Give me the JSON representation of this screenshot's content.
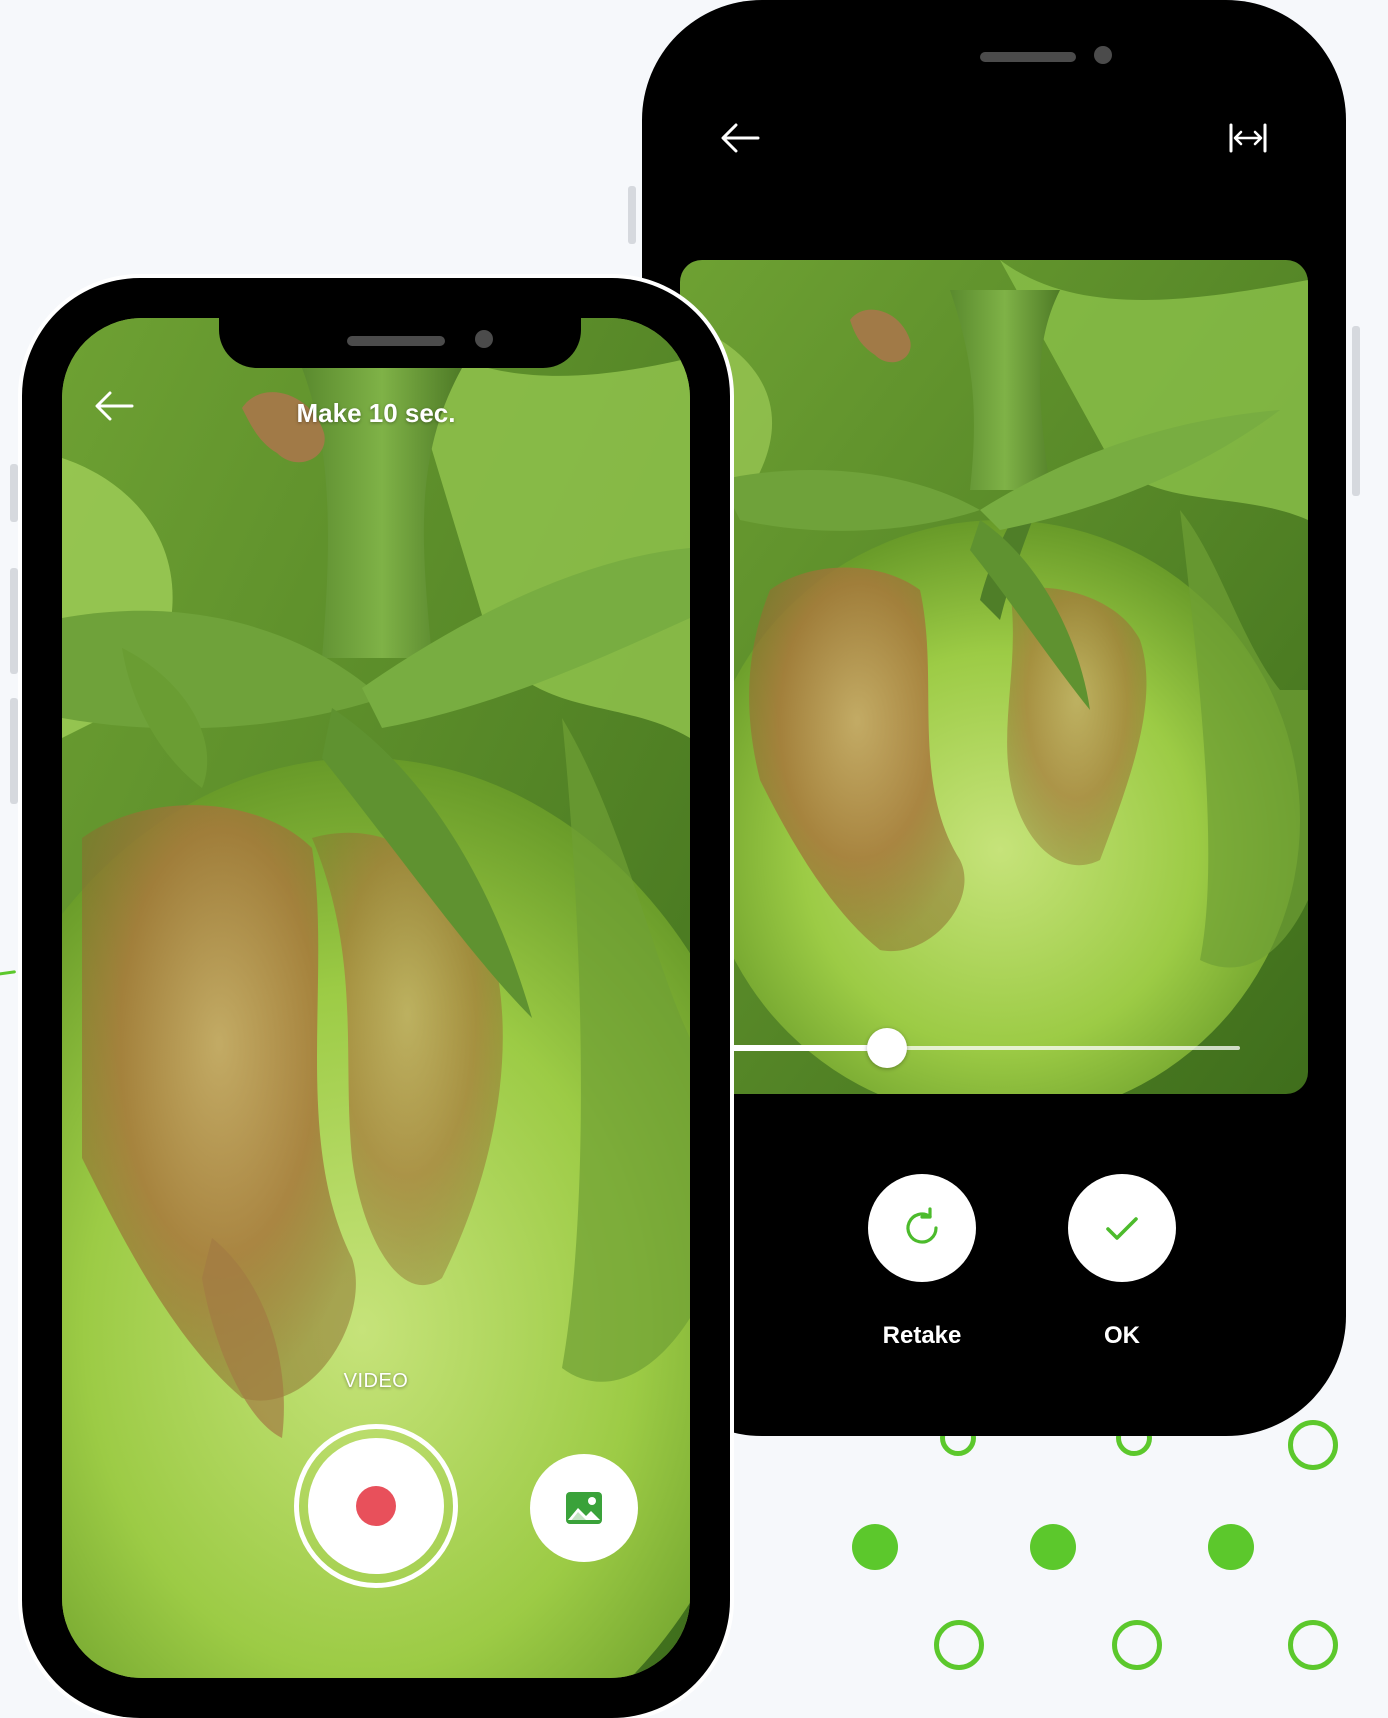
{
  "capture_screen": {
    "title": "Make 10 sec.",
    "mode_label": "VIDEO",
    "back_icon": "arrow-left-icon",
    "record_icon": "record-dot-icon",
    "gallery_icon": "image-gallery-icon",
    "record_color": "#e8505b",
    "gallery_icon_color": "#3aa23a"
  },
  "preview_screen": {
    "back_icon": "arrow-left-icon",
    "fit_icon": "fit-width-icon",
    "slider_value": 0.37,
    "retake_label": "Retake",
    "ok_label": "OK",
    "retake_icon": "refresh-icon",
    "ok_icon": "check-icon",
    "accent_color": "#4cbb2c"
  },
  "decoration": {
    "dot_color": "#5cc82c"
  }
}
